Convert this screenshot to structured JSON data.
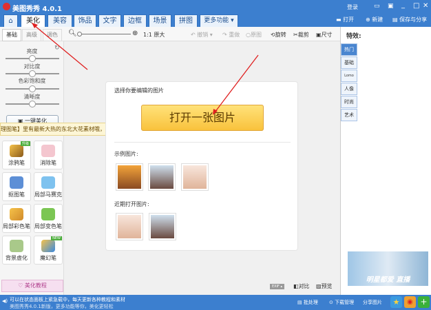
{
  "app": {
    "title": "美图秀秀 4.0.1",
    "login": "登录"
  },
  "tabs": [
    {
      "label": "美化"
    },
    {
      "label": "美容"
    },
    {
      "label": "饰品"
    },
    {
      "label": "文字"
    },
    {
      "label": "边框"
    },
    {
      "label": "场景"
    },
    {
      "label": "拼图"
    },
    {
      "label": "更多功能 ▾"
    }
  ],
  "top_actions": {
    "open": "打开",
    "new": "新建",
    "save_share": "保存与分享"
  },
  "toolbar": {
    "subtabs": [
      "基础",
      "高级",
      "调色"
    ],
    "zoom_actual": "1:1 原大",
    "undo": "撤销",
    "redo": "重做",
    "original": "原图",
    "rotate": "旋转",
    "crop": "裁剪",
    "size": "尺寸"
  },
  "left": {
    "sliders": [
      {
        "label": "亮度",
        "value": 0.5
      },
      {
        "label": "对比度",
        "value": 0.5
      },
      {
        "label": "色彩饱和度",
        "value": 0.5
      },
      {
        "label": "清晰度",
        "value": 0.5
      }
    ],
    "one_click": "一键美化",
    "tools": [
      {
        "label": "涂鸦笔",
        "badge": "升级"
      },
      {
        "label": "消除笔"
      },
      {
        "label": "抠图笔"
      },
      {
        "label": "局部马赛克"
      },
      {
        "label": "局部彩色笔"
      },
      {
        "label": "局部变色笔"
      },
      {
        "label": "背景虚化"
      },
      {
        "label": "魔幻笔",
        "badge": "NEW"
      }
    ],
    "tutorial": "美化教程"
  },
  "tip": {
    "text": "理图笔】里有最新大热的东北大花素材哦，快来试试!",
    "close": "✕"
  },
  "main": {
    "prompt": "选择你要编辑的图片",
    "open_button": "打开一张图片",
    "examples_label": "示例图片:",
    "recent_label": "近期打开图片:"
  },
  "right": {
    "title": "特效:",
    "tabs": [
      "热门",
      "基础",
      "Lomo",
      "人像",
      "时尚",
      "艺术"
    ],
    "banner": "明星都爱 直播"
  },
  "bottom_bar": {
    "exif": "EXIF ▴",
    "compare": "对比",
    "preview": "预览"
  },
  "status": {
    "line1": "可以在状态面板上紧急载中，每天更新各种教程和素材",
    "line2": "美图秀秀4.0.1新版，更多功能等你，美化更轻松",
    "batch": "批处理",
    "download": "下载管理",
    "share": "分享图片"
  }
}
